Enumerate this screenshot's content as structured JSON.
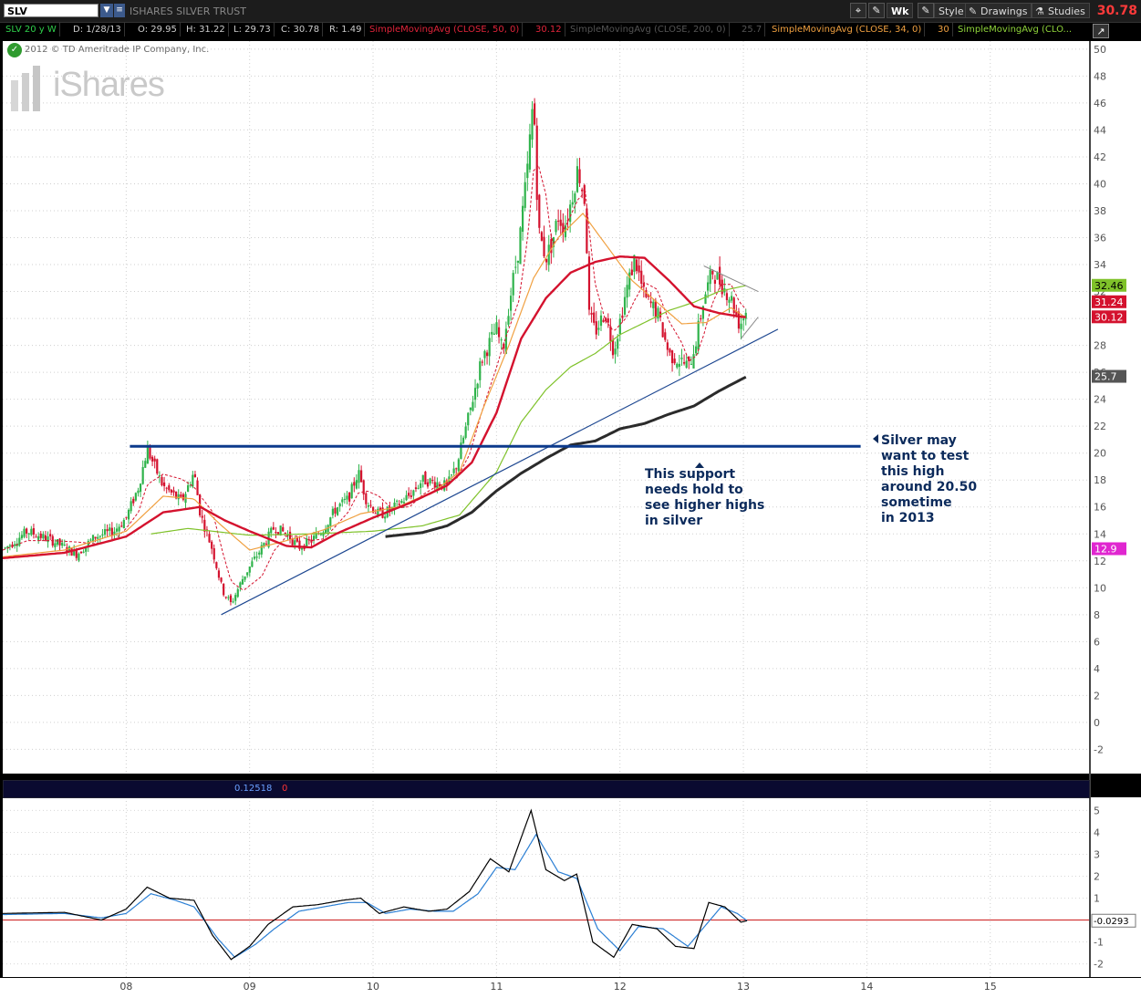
{
  "toolbar": {
    "symbol": "SLV",
    "symbol_name": "ISHARES SILVER TRUST",
    "aggregation": "Wk",
    "style_label": "Style",
    "drawings_label": "Drawings",
    "studies_label": "Studies",
    "last_price": "30.78"
  },
  "info_bar": {
    "period": "SLV 20 y W",
    "date": "D: 1/28/13",
    "open": "O: 29.95",
    "high": "H: 31.22",
    "low": "L: 29.73",
    "close": "C: 30.78",
    "range": "R: 1.49",
    "sma50_label": "SimpleMovingAvg (CLOSE, 50, 0)",
    "sma50_value": "30.12",
    "sma200_label": "SimpleMovingAvg (CLOSE, 200, 0)",
    "sma200_value": "25.7",
    "sma34_label": "SimpleMovingAvg (CLOSE, 34, 0)",
    "sma34_value": "30",
    "smaX_label": "SimpleMovingAvg (CLO..."
  },
  "lower_info": {
    "value1": "0.12518",
    "value2": "0"
  },
  "copyright": "2012 © TD Ameritrade IP Company, Inc.",
  "watermark": "iShares",
  "annotations": {
    "support": "This support\nneeds hold to\nsee higher highs\nin silver",
    "test": "Silver may\nwant to test\nthis high\naround 20.50\nsometime\nin 2013"
  },
  "colors": {
    "bull": "#2fb34b",
    "bear": "#d4122e",
    "sma50": "#d4122e",
    "sma34": "#f0a040",
    "sma200": "#2b2b2b",
    "smaGreen": "#7fc22a",
    "smaDash": "#d4122e",
    "trend": "#1c4690",
    "osc_fast": "#000000",
    "osc_slow": "#2b7fd4",
    "osc_zero": "#cc1e1e"
  },
  "chart_data": [
    {
      "type": "candlestick",
      "title": "",
      "x_tick_labels": [
        "08",
        "09",
        "10",
        "11",
        "12",
        "13",
        "14",
        "15"
      ],
      "y_ticks": [
        50,
        48,
        46,
        44,
        42,
        40,
        38,
        36,
        34,
        32,
        30,
        28,
        26,
        24,
        22,
        20,
        18,
        16,
        14,
        12,
        10,
        8,
        6,
        4,
        2,
        0,
        -2
      ],
      "ylim": [
        -3.8,
        50.6
      ],
      "xlim": [
        2007.0,
        2015.8
      ],
      "grid": true,
      "price_key": [
        [
          2007.0,
          12.8
        ],
        [
          2007.2,
          14.2
        ],
        [
          2007.4,
          13.5
        ],
        [
          2007.6,
          12.5
        ],
        [
          2007.75,
          13.8
        ],
        [
          2007.9,
          14.2
        ],
        [
          2008.0,
          15.2
        ],
        [
          2008.1,
          17.5
        ],
        [
          2008.17,
          20.3
        ],
        [
          2008.3,
          17.5
        ],
        [
          2008.45,
          16.4
        ],
        [
          2008.55,
          18.6
        ],
        [
          2008.6,
          15.5
        ],
        [
          2008.7,
          12.8
        ],
        [
          2008.78,
          9.8
        ],
        [
          2008.85,
          8.8
        ],
        [
          2008.95,
          10.8
        ],
        [
          2009.1,
          13.0
        ],
        [
          2009.2,
          14.5
        ],
        [
          2009.3,
          14.0
        ],
        [
          2009.4,
          13.0
        ],
        [
          2009.5,
          13.5
        ],
        [
          2009.6,
          14.4
        ],
        [
          2009.7,
          15.9
        ],
        [
          2009.8,
          16.6
        ],
        [
          2009.88,
          18.6
        ],
        [
          2009.95,
          16.4
        ],
        [
          2010.05,
          15.4
        ],
        [
          2010.15,
          15.8
        ],
        [
          2010.3,
          16.9
        ],
        [
          2010.4,
          18.0
        ],
        [
          2010.52,
          17.8
        ],
        [
          2010.6,
          17.5
        ],
        [
          2010.68,
          19.2
        ],
        [
          2010.78,
          22.9
        ],
        [
          2010.88,
          27.0
        ],
        [
          2011.0,
          29.2
        ],
        [
          2011.05,
          27.5
        ],
        [
          2011.1,
          31.0
        ],
        [
          2011.18,
          35.3
        ],
        [
          2011.25,
          41.0
        ],
        [
          2011.3,
          46.6
        ],
        [
          2011.34,
          36.5
        ],
        [
          2011.4,
          34.5
        ],
        [
          2011.45,
          35.6
        ],
        [
          2011.5,
          37.6
        ],
        [
          2011.55,
          36.8
        ],
        [
          2011.6,
          38.5
        ],
        [
          2011.66,
          41.2
        ],
        [
          2011.72,
          38.5
        ],
        [
          2011.75,
          30.2
        ],
        [
          2011.8,
          29.0
        ],
        [
          2011.88,
          30.5
        ],
        [
          2011.95,
          27.6
        ],
        [
          2012.05,
          32.0
        ],
        [
          2012.12,
          34.5
        ],
        [
          2012.2,
          31.5
        ],
        [
          2012.3,
          30.5
        ],
        [
          2012.4,
          27.3
        ],
        [
          2012.5,
          26.8
        ],
        [
          2012.56,
          26.4
        ],
        [
          2012.62,
          28.5
        ],
        [
          2012.68,
          31.5
        ],
        [
          2012.75,
          33.5
        ],
        [
          2012.82,
          32.6
        ],
        [
          2012.9,
          31.5
        ],
        [
          2012.97,
          29.5
        ],
        [
          2013.03,
          30.78
        ]
      ],
      "sma50_key": [
        [
          2007.0,
          12.2
        ],
        [
          2007.5,
          12.6
        ],
        [
          2008.0,
          13.8
        ],
        [
          2008.3,
          15.6
        ],
        [
          2008.6,
          16.0
        ],
        [
          2008.8,
          15.0
        ],
        [
          2009.0,
          14.2
        ],
        [
          2009.3,
          13.1
        ],
        [
          2009.5,
          13.0
        ],
        [
          2009.7,
          14.0
        ],
        [
          2010.0,
          15.2
        ],
        [
          2010.3,
          16.3
        ],
        [
          2010.6,
          17.6
        ],
        [
          2010.8,
          19.3
        ],
        [
          2011.0,
          23.0
        ],
        [
          2011.2,
          28.5
        ],
        [
          2011.4,
          31.5
        ],
        [
          2011.6,
          33.4
        ],
        [
          2011.8,
          34.2
        ],
        [
          2012.0,
          34.6
        ],
        [
          2012.2,
          34.5
        ],
        [
          2012.4,
          32.8
        ],
        [
          2012.6,
          30.9
        ],
        [
          2012.8,
          30.4
        ],
        [
          2013.0,
          30.1
        ],
        [
          2013.03,
          30.12
        ]
      ],
      "sma34_key": [
        [
          2007.0,
          12.3
        ],
        [
          2007.5,
          12.8
        ],
        [
          2008.0,
          14.2
        ],
        [
          2008.3,
          16.8
        ],
        [
          2008.55,
          16.6
        ],
        [
          2008.75,
          14.8
        ],
        [
          2009.0,
          12.8
        ],
        [
          2009.3,
          13.5
        ],
        [
          2009.6,
          14.3
        ],
        [
          2009.9,
          15.5
        ],
        [
          2010.2,
          16.0
        ],
        [
          2010.5,
          17.2
        ],
        [
          2010.7,
          18.6
        ],
        [
          2010.9,
          23.5
        ],
        [
          2011.1,
          28.0
        ],
        [
          2011.3,
          33.0
        ],
        [
          2011.5,
          36.0
        ],
        [
          2011.7,
          37.8
        ],
        [
          2011.9,
          35.3
        ],
        [
          2012.1,
          32.8
        ],
        [
          2012.3,
          31.2
        ],
        [
          2012.5,
          29.6
        ],
        [
          2012.7,
          29.7
        ],
        [
          2012.9,
          30.8
        ],
        [
          2013.03,
          30.0
        ]
      ],
      "sma200_key": [
        [
          2010.1,
          13.8
        ],
        [
          2010.4,
          14.1
        ],
        [
          2010.6,
          14.6
        ],
        [
          2010.8,
          15.6
        ],
        [
          2011.0,
          17.2
        ],
        [
          2011.2,
          18.5
        ],
        [
          2011.4,
          19.6
        ],
        [
          2011.6,
          20.6
        ],
        [
          2011.8,
          20.9
        ],
        [
          2012.0,
          21.8
        ],
        [
          2012.2,
          22.2
        ],
        [
          2012.4,
          22.9
        ],
        [
          2012.6,
          23.5
        ],
        [
          2012.8,
          24.6
        ],
        [
          2013.03,
          25.7
        ]
      ],
      "smaGreen_key": [
        [
          2008.2,
          14.0
        ],
        [
          2008.5,
          14.4
        ],
        [
          2008.8,
          14.1
        ],
        [
          2009.0,
          13.9
        ],
        [
          2009.5,
          14.0
        ],
        [
          2010.0,
          14.2
        ],
        [
          2010.4,
          14.6
        ],
        [
          2010.7,
          15.4
        ],
        [
          2011.0,
          18.6
        ],
        [
          2011.2,
          22.3
        ],
        [
          2011.4,
          24.7
        ],
        [
          2011.6,
          26.4
        ],
        [
          2011.8,
          27.4
        ],
        [
          2012.0,
          28.8
        ],
        [
          2012.2,
          29.7
        ],
        [
          2012.4,
          30.6
        ],
        [
          2012.6,
          31.2
        ],
        [
          2012.8,
          32.0
        ],
        [
          2013.03,
          32.46
        ]
      ],
      "trendlines": [
        {
          "name": "support",
          "from": [
            2008.77,
            8.0
          ],
          "to": [
            2013.28,
            29.2
          ]
        },
        {
          "name": "horizontal",
          "from": [
            2008.03,
            20.5
          ],
          "to": [
            2013.95,
            20.5
          ]
        },
        {
          "name": "triangle_upper",
          "from": [
            2012.68,
            33.9
          ],
          "to": [
            2013.12,
            32.0
          ]
        },
        {
          "name": "triangle_lower",
          "from": [
            2012.98,
            28.5
          ],
          "to": [
            2013.12,
            30.1
          ]
        }
      ],
      "price_labels": [
        "32.46",
        "31.24",
        "30.12",
        "25.7",
        "12.9"
      ]
    },
    {
      "type": "line",
      "name": "lower_oscillator",
      "y_ticks": [
        5,
        4,
        3,
        2,
        1,
        0,
        -1,
        -2
      ],
      "ylim": [
        -2.6,
        5.6
      ],
      "zero_line": 0,
      "fast_key": [
        [
          2007.0,
          0.3
        ],
        [
          2007.5,
          0.35
        ],
        [
          2007.8,
          0.0
        ],
        [
          2008.0,
          0.5
        ],
        [
          2008.17,
          1.5
        ],
        [
          2008.35,
          1.0
        ],
        [
          2008.55,
          0.9
        ],
        [
          2008.7,
          -0.7
        ],
        [
          2008.85,
          -1.8
        ],
        [
          2009.0,
          -1.2
        ],
        [
          2009.15,
          -0.2
        ],
        [
          2009.35,
          0.6
        ],
        [
          2009.55,
          0.7
        ],
        [
          2009.75,
          0.9
        ],
        [
          2009.9,
          1.0
        ],
        [
          2010.05,
          0.3
        ],
        [
          2010.25,
          0.6
        ],
        [
          2010.45,
          0.4
        ],
        [
          2010.6,
          0.5
        ],
        [
          2010.78,
          1.3
        ],
        [
          2010.95,
          2.8
        ],
        [
          2011.1,
          2.2
        ],
        [
          2011.28,
          5.0
        ],
        [
          2011.4,
          2.3
        ],
        [
          2011.55,
          1.8
        ],
        [
          2011.65,
          2.1
        ],
        [
          2011.78,
          -1.0
        ],
        [
          2011.95,
          -1.7
        ],
        [
          2012.1,
          -0.2
        ],
        [
          2012.3,
          -0.4
        ],
        [
          2012.45,
          -1.2
        ],
        [
          2012.6,
          -1.3
        ],
        [
          2012.72,
          0.8
        ],
        [
          2012.85,
          0.6
        ],
        [
          2012.98,
          -0.1
        ],
        [
          2013.03,
          -0.03
        ]
      ],
      "slow_key": [
        [
          2007.0,
          0.25
        ],
        [
          2007.5,
          0.3
        ],
        [
          2007.8,
          0.1
        ],
        [
          2008.0,
          0.3
        ],
        [
          2008.2,
          1.2
        ],
        [
          2008.4,
          0.9
        ],
        [
          2008.55,
          0.6
        ],
        [
          2008.75,
          -0.9
        ],
        [
          2008.88,
          -1.7
        ],
        [
          2009.05,
          -1.1
        ],
        [
          2009.2,
          -0.4
        ],
        [
          2009.4,
          0.4
        ],
        [
          2009.6,
          0.6
        ],
        [
          2009.8,
          0.8
        ],
        [
          2009.95,
          0.8
        ],
        [
          2010.1,
          0.3
        ],
        [
          2010.3,
          0.5
        ],
        [
          2010.5,
          0.4
        ],
        [
          2010.65,
          0.4
        ],
        [
          2010.85,
          1.2
        ],
        [
          2011.0,
          2.4
        ],
        [
          2011.15,
          2.3
        ],
        [
          2011.32,
          3.9
        ],
        [
          2011.5,
          2.2
        ],
        [
          2011.65,
          1.9
        ],
        [
          2011.82,
          -0.4
        ],
        [
          2012.0,
          -1.4
        ],
        [
          2012.15,
          -0.3
        ],
        [
          2012.35,
          -0.4
        ],
        [
          2012.55,
          -1.2
        ],
        [
          2012.7,
          -0.2
        ],
        [
          2012.82,
          0.6
        ],
        [
          2012.95,
          0.3
        ],
        [
          2013.03,
          -0.03
        ]
      ],
      "value_label": "-0.0293"
    }
  ]
}
